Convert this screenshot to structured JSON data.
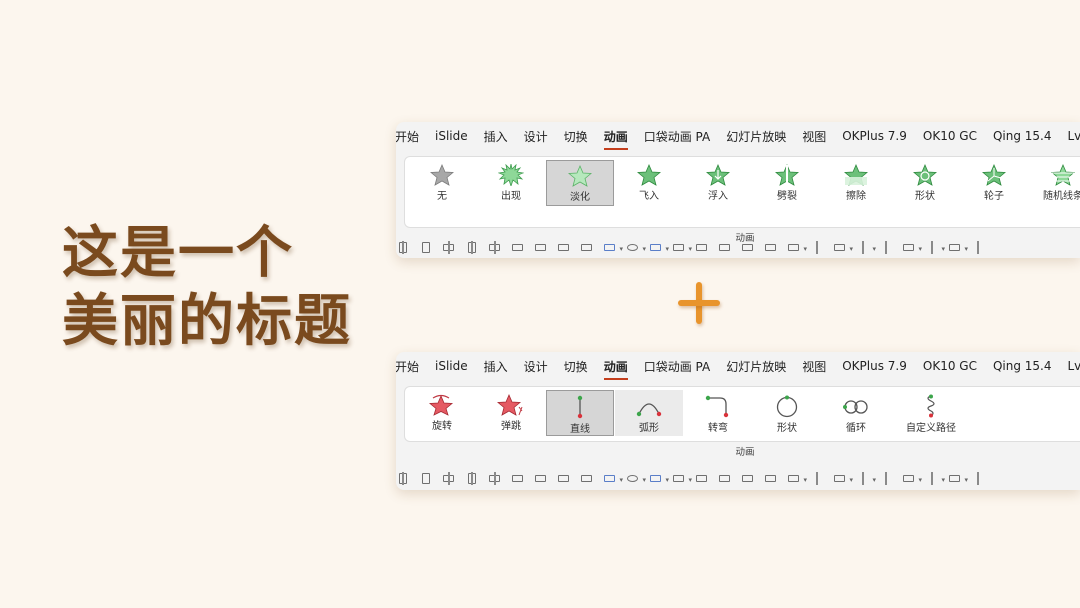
{
  "colors": {
    "background": "#fcf6ee",
    "title": "#7a4a1e",
    "plus": "#e8942c",
    "active_tab_underline": "#c43e1c",
    "star_green": "#6cc07a",
    "star_gray": "#a8a8a8",
    "star_red": "#e0505a"
  },
  "title": {
    "line1": "这是一个",
    "line2": "美丽的标题"
  },
  "plus": "+",
  "ribbons": [
    {
      "tabs": [
        {
          "label": "开始",
          "active": false
        },
        {
          "label": "iSlide",
          "active": false
        },
        {
          "label": "插入",
          "active": false
        },
        {
          "label": "设计",
          "active": false
        },
        {
          "label": "切换",
          "active": false
        },
        {
          "label": "动画",
          "active": true
        },
        {
          "label": "口袋动画 PA",
          "active": false
        },
        {
          "label": "幻灯片放映",
          "active": false
        },
        {
          "label": "视图",
          "active": false
        },
        {
          "label": "OKPlus 7.9",
          "active": false
        },
        {
          "label": "OK10 GC",
          "active": false
        },
        {
          "label": "Qing 15.4",
          "active": false
        },
        {
          "label": "LvyhTo",
          "active": false
        }
      ],
      "group_label": "动画",
      "items": [
        {
          "label": "无",
          "icon": "star-gray-icon",
          "state": ""
        },
        {
          "label": "出现",
          "icon": "star-burst-icon",
          "state": ""
        },
        {
          "label": "淡化",
          "icon": "star-fade-icon",
          "state": "selected"
        },
        {
          "label": "飞入",
          "icon": "star-fly-icon",
          "state": ""
        },
        {
          "label": "浮入",
          "icon": "star-float-icon",
          "state": ""
        },
        {
          "label": "劈裂",
          "icon": "star-split-icon",
          "state": ""
        },
        {
          "label": "擦除",
          "icon": "star-wipe-icon",
          "state": ""
        },
        {
          "label": "形状",
          "icon": "star-shape-icon",
          "state": ""
        },
        {
          "label": "轮子",
          "icon": "star-wheel-icon",
          "state": ""
        },
        {
          "label": "随机线条",
          "icon": "star-random-bars-icon",
          "state": ""
        }
      ]
    },
    {
      "tabs": [
        {
          "label": "开始",
          "active": false
        },
        {
          "label": "iSlide",
          "active": false
        },
        {
          "label": "插入",
          "active": false
        },
        {
          "label": "设计",
          "active": false
        },
        {
          "label": "切换",
          "active": false
        },
        {
          "label": "动画",
          "active": true
        },
        {
          "label": "口袋动画 PA",
          "active": false
        },
        {
          "label": "幻灯片放映",
          "active": false
        },
        {
          "label": "视图",
          "active": false
        },
        {
          "label": "OKPlus 7.9",
          "active": false
        },
        {
          "label": "OK10 GC",
          "active": false
        },
        {
          "label": "Qing 15.4",
          "active": false
        },
        {
          "label": "LvyhTo",
          "active": false
        }
      ],
      "group_label": "动画",
      "items": [
        {
          "label": "旋转",
          "icon": "star-spin-icon",
          "state": ""
        },
        {
          "label": "弹跳",
          "icon": "star-bounce-icon",
          "state": ""
        },
        {
          "label": "直线",
          "icon": "path-line-icon",
          "state": "selected"
        },
        {
          "label": "弧形",
          "icon": "path-arc-icon",
          "state": "hover"
        },
        {
          "label": "转弯",
          "icon": "path-turn-icon",
          "state": ""
        },
        {
          "label": "形状",
          "icon": "path-shape-icon",
          "state": ""
        },
        {
          "label": "循环",
          "icon": "path-loop-icon",
          "state": ""
        },
        {
          "label": "自定义路径",
          "icon": "path-custom-icon",
          "state": ""
        }
      ]
    }
  ],
  "toolbar_icons": [
    "align-left-icon",
    "align-top-icon",
    "align-center-icon",
    "align-bottom-icon",
    "distribute-horizontal-icon",
    "distribute-vertical-icon",
    "group-icon",
    "ungroup-icon",
    "match-size-icon",
    "rotate-icon",
    "merge-shapes-icon",
    "shape-fill-icon",
    "shape-outline-icon",
    "bring-forward-icon",
    "send-backward-icon",
    "bring-to-front-icon",
    "send-to-back-icon",
    "fill-color-icon",
    "eyedropper-icon",
    "line-style-icon",
    "font-color-icon",
    "text-eyedropper-icon",
    "text-outline-icon",
    "strikethrough-icon",
    "character-spacing-icon",
    "change-case-icon"
  ]
}
